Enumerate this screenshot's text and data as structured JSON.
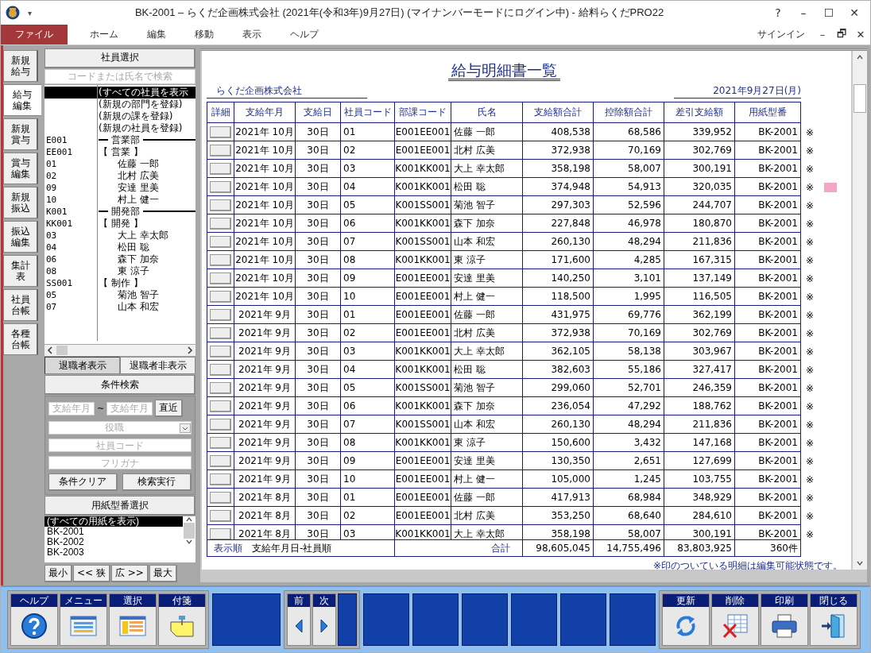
{
  "window": {
    "title": "BK-2001 – らくだ企画株式会社 (2021年(令和3年)9月27日) (マイナンバーモードにログイン中) - 給料らくだPRO22",
    "quick_access": "▾",
    "controls": [
      "?",
      "–",
      "☐",
      "✕"
    ]
  },
  "menu": {
    "items": [
      {
        "label": "ファイル",
        "selected": true
      },
      {
        "label": "ホーム",
        "selected": false
      },
      {
        "label": "編集",
        "selected": false
      },
      {
        "label": "移動",
        "selected": false
      },
      {
        "label": "表示",
        "selected": false
      },
      {
        "label": "ヘルプ",
        "selected": false
      }
    ],
    "sign_in": "サインイン",
    "controls": [
      "–",
      "🗗",
      "✕"
    ]
  },
  "side_tabs": [
    {
      "label": "新規給与",
      "selected": false
    },
    {
      "label": "給与編集",
      "selected": true
    },
    {
      "label": "新規賞与",
      "selected": false
    },
    {
      "label": "賞与編集",
      "selected": false
    },
    {
      "label": "新規振込",
      "selected": false
    },
    {
      "label": "振込編集",
      "selected": false
    },
    {
      "label": "集計表",
      "selected": false
    },
    {
      "label": "社員台帳",
      "selected": false
    },
    {
      "label": "各種台帳",
      "selected": false
    }
  ],
  "employee_select": {
    "title": "社員選択",
    "search": {
      "placeholder": "コードまたは氏名で検索"
    },
    "actions": [
      {
        "label": "(すべての社員を表示",
        "selected": true
      },
      {
        "label": "(新規の部門を登録)",
        "selected": false
      },
      {
        "label": "(新規の課を登録)",
        "selected": false
      },
      {
        "label": "(新規の社員を登録)",
        "selected": false
      }
    ],
    "departments": [
      {
        "code": "E001",
        "name": "営業部",
        "children": [
          {
            "code": "EE001",
            "name": "【 営業 】",
            "children": [
              {
                "code": "01",
                "name": "佐藤 一郎"
              },
              {
                "code": "02",
                "name": "北村 広美"
              },
              {
                "code": "09",
                "name": "安達 里美"
              },
              {
                "code": "10",
                "name": "村上 健一"
              }
            ]
          }
        ]
      },
      {
        "code": "K001",
        "name": "開発部",
        "children": [
          {
            "code": "KK001",
            "name": "【 開発 】",
            "children": [
              {
                "code": "03",
                "name": "大上 幸太郎"
              },
              {
                "code": "04",
                "name": "松田 聡"
              },
              {
                "code": "06",
                "name": "森下 加奈"
              },
              {
                "code": "08",
                "name": "東 涼子"
              }
            ]
          },
          {
            "code": "SS001",
            "name": "【 制作 】",
            "children": [
              {
                "code": "05",
                "name": "菊池 智子"
              },
              {
                "code": "07",
                "name": "山本 和宏"
              }
            ]
          }
        ]
      }
    ],
    "retired_tabs": [
      {
        "label": "退職者表示",
        "selected": true
      },
      {
        "label": "退職者非表示",
        "selected": false
      }
    ]
  },
  "condition_search": {
    "title": "条件検索",
    "from": {
      "placeholder": "支給年月"
    },
    "tilde": "~",
    "to": {
      "placeholder": "支給年月"
    },
    "recent": "直近",
    "position": {
      "placeholder": "役職"
    },
    "employee_code": {
      "placeholder": "社員コード"
    },
    "furigana": {
      "placeholder": "フリガナ"
    },
    "clear": "条件クリア",
    "run": "検索実行"
  },
  "form_select": {
    "title": "用紙型番選択",
    "items": [
      {
        "label": "(すべての用紙を表示)",
        "selected": true
      },
      {
        "label": "BK-2001",
        "selected": false
      },
      {
        "label": "BK-2002",
        "selected": false
      },
      {
        "label": "BK-2003",
        "selected": false
      }
    ],
    "buttons": [
      "最小",
      "<< 狭",
      "広 >>",
      "最大"
    ]
  },
  "report": {
    "title": "給与明細書一覧",
    "company": "らくだ企画株式会社",
    "date": "2021年9月27日(月)",
    "columns": [
      "詳細",
      "支給年月",
      "支給日",
      "社員コード",
      "部課コード",
      "氏名",
      "支給額合計",
      "控除額合計",
      "差引支給額",
      "用紙型番"
    ],
    "rows": [
      {
        "month": "2021年 10月",
        "day": "30日",
        "code": "01",
        "dept": "E001EE001",
        "name": "佐藤 一郎",
        "pay": "408,538",
        "deduction": "68,586",
        "net": "339,952",
        "form": "BK-2001",
        "mark": "※",
        "flagged": false
      },
      {
        "month": "2021年 10月",
        "day": "30日",
        "code": "02",
        "dept": "E001EE001",
        "name": "北村 広美",
        "pay": "372,938",
        "deduction": "70,169",
        "net": "302,769",
        "form": "BK-2001",
        "mark": "※",
        "flagged": false
      },
      {
        "month": "2021年 10月",
        "day": "30日",
        "code": "03",
        "dept": "K001KK001",
        "name": "大上 幸太郎",
        "pay": "358,198",
        "deduction": "58,007",
        "net": "300,191",
        "form": "BK-2001",
        "mark": "※",
        "flagged": false
      },
      {
        "month": "2021年 10月",
        "day": "30日",
        "code": "04",
        "dept": "K001KK001",
        "name": "松田 聡",
        "pay": "374,948",
        "deduction": "54,913",
        "net": "320,035",
        "form": "BK-2001",
        "mark": "※",
        "flagged": true
      },
      {
        "month": "2021年 10月",
        "day": "30日",
        "code": "05",
        "dept": "K001SS001",
        "name": "菊池 智子",
        "pay": "297,303",
        "deduction": "52,596",
        "net": "244,707",
        "form": "BK-2001",
        "mark": "※",
        "flagged": false
      },
      {
        "month": "2021年 10月",
        "day": "30日",
        "code": "06",
        "dept": "K001KK001",
        "name": "森下 加奈",
        "pay": "227,848",
        "deduction": "46,978",
        "net": "180,870",
        "form": "BK-2001",
        "mark": "※",
        "flagged": false
      },
      {
        "month": "2021年 10月",
        "day": "30日",
        "code": "07",
        "dept": "K001SS001",
        "name": "山本 和宏",
        "pay": "260,130",
        "deduction": "48,294",
        "net": "211,836",
        "form": "BK-2001",
        "mark": "※",
        "flagged": false
      },
      {
        "month": "2021年 10月",
        "day": "30日",
        "code": "08",
        "dept": "K001KK001",
        "name": "東 涼子",
        "pay": "171,600",
        "deduction": "4,285",
        "net": "167,315",
        "form": "BK-2001",
        "mark": "※",
        "flagged": false
      },
      {
        "month": "2021年 10月",
        "day": "30日",
        "code": "09",
        "dept": "E001EE001",
        "name": "安達 里美",
        "pay": "140,250",
        "deduction": "3,101",
        "net": "137,149",
        "form": "BK-2001",
        "mark": "※",
        "flagged": false
      },
      {
        "month": "2021年 10月",
        "day": "30日",
        "code": "10",
        "dept": "E001EE001",
        "name": "村上 健一",
        "pay": "118,500",
        "deduction": "1,995",
        "net": "116,505",
        "form": "BK-2001",
        "mark": "※",
        "flagged": false
      },
      {
        "month": "2021年 9月",
        "day": "30日",
        "code": "01",
        "dept": "E001EE001",
        "name": "佐藤 一郎",
        "pay": "431,975",
        "deduction": "69,776",
        "net": "362,199",
        "form": "BK-2001",
        "mark": "※",
        "flagged": false
      },
      {
        "month": "2021年 9月",
        "day": "30日",
        "code": "02",
        "dept": "E001EE001",
        "name": "北村 広美",
        "pay": "372,938",
        "deduction": "70,169",
        "net": "302,769",
        "form": "BK-2001",
        "mark": "※",
        "flagged": false
      },
      {
        "month": "2021年 9月",
        "day": "30日",
        "code": "03",
        "dept": "K001KK001",
        "name": "大上 幸太郎",
        "pay": "362,105",
        "deduction": "58,138",
        "net": "303,967",
        "form": "BK-2001",
        "mark": "※",
        "flagged": false
      },
      {
        "month": "2021年 9月",
        "day": "30日",
        "code": "04",
        "dept": "K001KK001",
        "name": "松田 聡",
        "pay": "382,603",
        "deduction": "55,186",
        "net": "327,417",
        "form": "BK-2001",
        "mark": "※",
        "flagged": false
      },
      {
        "month": "2021年 9月",
        "day": "30日",
        "code": "05",
        "dept": "K001SS001",
        "name": "菊池 智子",
        "pay": "299,060",
        "deduction": "52,701",
        "net": "246,359",
        "form": "BK-2001",
        "mark": "※",
        "flagged": false
      },
      {
        "month": "2021年 9月",
        "day": "30日",
        "code": "06",
        "dept": "K001KK001",
        "name": "森下 加奈",
        "pay": "236,054",
        "deduction": "47,292",
        "net": "188,762",
        "form": "BK-2001",
        "mark": "※",
        "flagged": false
      },
      {
        "month": "2021年 9月",
        "day": "30日",
        "code": "07",
        "dept": "K001SS001",
        "name": "山本 和宏",
        "pay": "260,130",
        "deduction": "48,294",
        "net": "211,836",
        "form": "BK-2001",
        "mark": "※",
        "flagged": false
      },
      {
        "month": "2021年 9月",
        "day": "30日",
        "code": "08",
        "dept": "K001KK001",
        "name": "東 涼子",
        "pay": "150,600",
        "deduction": "3,432",
        "net": "147,168",
        "form": "BK-2001",
        "mark": "※",
        "flagged": false
      },
      {
        "month": "2021年 9月",
        "day": "30日",
        "code": "09",
        "dept": "E001EE001",
        "name": "安達 里美",
        "pay": "130,350",
        "deduction": "2,651",
        "net": "127,699",
        "form": "BK-2001",
        "mark": "※",
        "flagged": false
      },
      {
        "month": "2021年 9月",
        "day": "30日",
        "code": "10",
        "dept": "E001EE001",
        "name": "村上 健一",
        "pay": "105,000",
        "deduction": "1,245",
        "net": "103,755",
        "form": "BK-2001",
        "mark": "※",
        "flagged": false
      },
      {
        "month": "2021年 8月",
        "day": "30日",
        "code": "01",
        "dept": "E001EE001",
        "name": "佐藤 一郎",
        "pay": "417,913",
        "deduction": "68,984",
        "net": "348,929",
        "form": "BK-2001",
        "mark": "※",
        "flagged": false
      },
      {
        "month": "2021年 8月",
        "day": "30日",
        "code": "02",
        "dept": "E001EE001",
        "name": "北村 広美",
        "pay": "353,250",
        "deduction": "68,640",
        "net": "284,610",
        "form": "BK-2001",
        "mark": "※",
        "flagged": false
      },
      {
        "month": "2021年 8月",
        "day": "30日",
        "code": "03",
        "dept": "K001KK001",
        "name": "大上 幸太郎",
        "pay": "358,198",
        "deduction": "58,007",
        "net": "300,191",
        "form": "BK-2001",
        "mark": "※",
        "flagged": false
      }
    ],
    "footer": {
      "order_label": "表示順",
      "order": "支給年月日-社員順",
      "total_label": "合計",
      "pay": "98,605,045",
      "deduction": "14,755,496",
      "net": "83,803,925",
      "count": "360件"
    },
    "note": "※印のついている明細は編集可能状態です。"
  },
  "toolbar": {
    "left": [
      {
        "label": "ヘルプ",
        "kind": "help"
      },
      {
        "label": "メニュー",
        "kind": "menu"
      },
      {
        "label": "選択",
        "kind": "select"
      },
      {
        "label": "付箋",
        "kind": "note"
      }
    ],
    "nav": [
      {
        "label": "前",
        "kind": "prev"
      },
      {
        "label": "次",
        "kind": "next"
      }
    ],
    "right": [
      {
        "label": "更新",
        "kind": "refresh"
      },
      {
        "label": "削除",
        "kind": "delete"
      },
      {
        "label": "印刷",
        "kind": "print"
      },
      {
        "label": "閉じる",
        "kind": "close"
      }
    ]
  }
}
